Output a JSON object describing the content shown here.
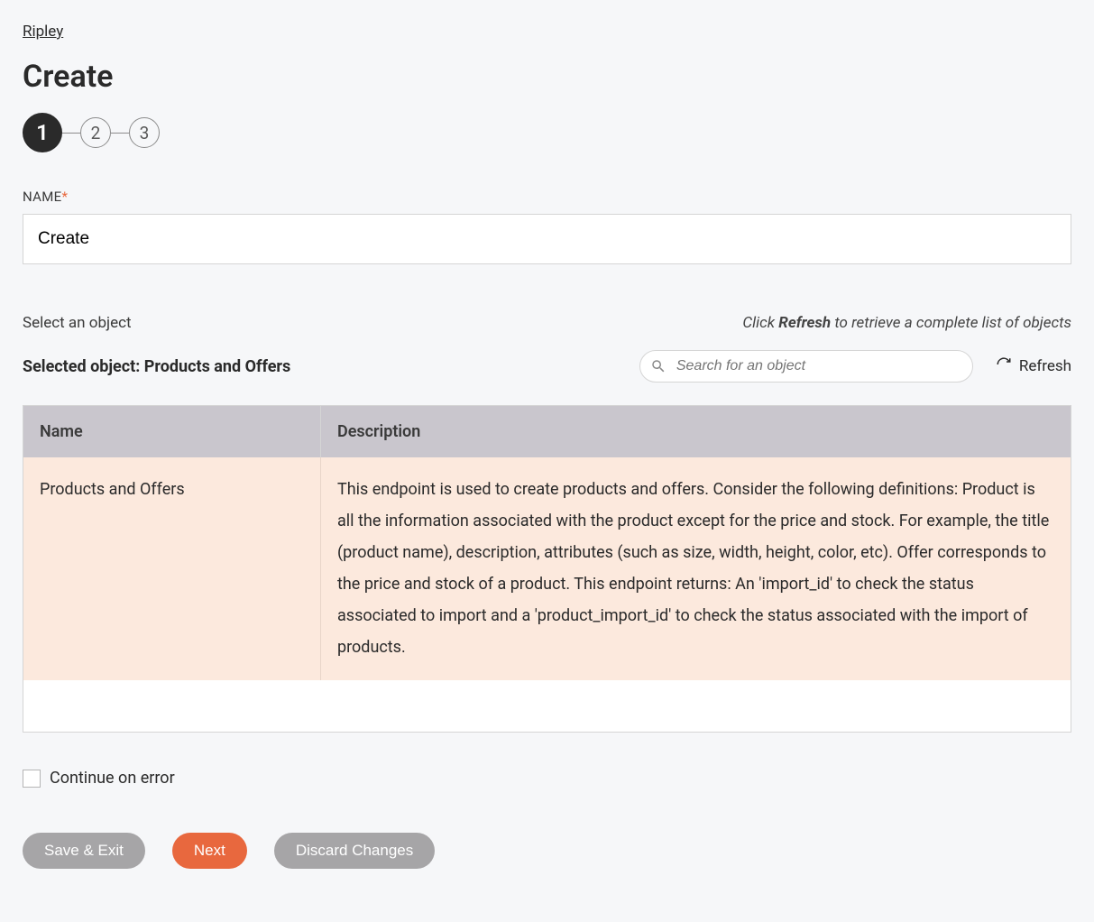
{
  "breadcrumb": "Ripley",
  "page_title": "Create",
  "steps": [
    "1",
    "2",
    "3"
  ],
  "name_field": {
    "label": "NAME",
    "required_marker": "*",
    "value": "Create"
  },
  "select_object": {
    "label": "Select an object",
    "hint_prefix": "Click ",
    "hint_bold": "Refresh",
    "hint_suffix": " to retrieve a complete list of objects",
    "selected_prefix": "Selected object: ",
    "selected_value": "Products and Offers",
    "search_placeholder": "Search for an object",
    "refresh_label": "Refresh"
  },
  "table": {
    "headers": [
      "Name",
      "Description"
    ],
    "rows": [
      {
        "name": "Products and Offers",
        "description": "This endpoint is used to create products and offers. Consider the following definitions: Product is all the information associated with the product except for the price and stock. For example, the title (product name), description, attributes (such as size, width, height, color, etc). Offer corresponds to the price and stock of a product. This endpoint returns: An 'import_id' to check the status associated to import and a 'product_import_id' to check the status associated with the import of products."
      }
    ]
  },
  "continue_on_error": {
    "label": "Continue on error",
    "checked": false
  },
  "buttons": {
    "save_exit": "Save & Exit",
    "next": "Next",
    "discard": "Discard Changes"
  }
}
